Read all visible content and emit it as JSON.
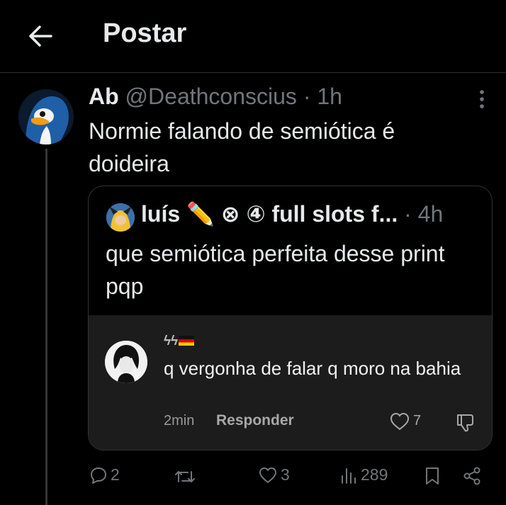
{
  "header": {
    "title": "Postar",
    "back_icon": "arrow-left-icon"
  },
  "post": {
    "author_name": "Ab",
    "handle": "@Deathconscius",
    "separator": "·",
    "time": "1h",
    "text": "Normie falando de semiótica é doideira",
    "more_icon": "more-vertical-icon",
    "avatar_icon": "penguin-avatar"
  },
  "quote": {
    "author_name": "luís ✏️ ⊗ ④ full slots f...",
    "separator": "·",
    "time": "4h",
    "text": "que semiótica perfeita desse print pqp",
    "screenshot": {
      "username": "ϟϟ",
      "flag_icon": "german-flag-icon",
      "comment": "q vergonha de falar q moro na bahia",
      "time": "2min",
      "reply_label": "Responder",
      "like_count": "7"
    }
  },
  "actions": {
    "replies": "2",
    "reposts": "",
    "likes": "3",
    "views": "289"
  },
  "colors": {
    "background": "#000000",
    "text": "#e7e9ea",
    "muted": "#71767b",
    "border": "#2f3336"
  }
}
